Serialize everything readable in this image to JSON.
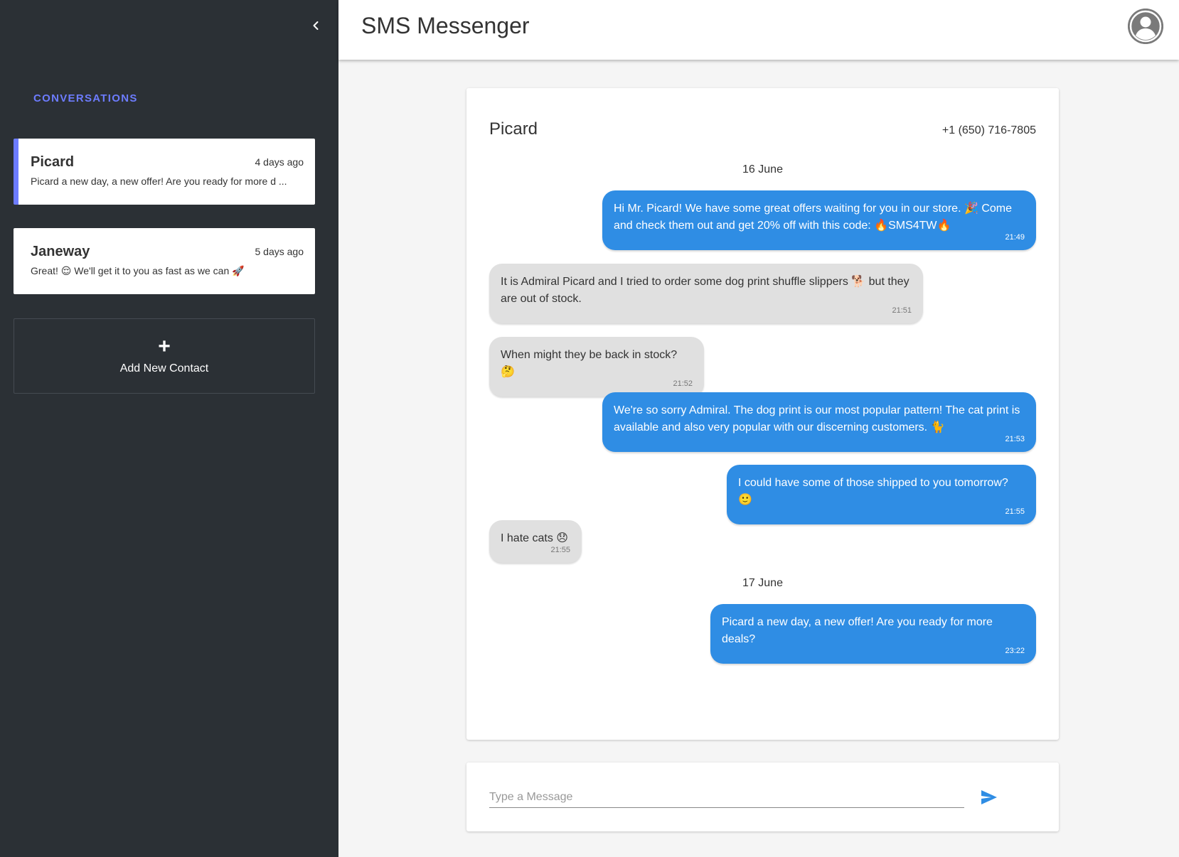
{
  "sidebar": {
    "section_title": "CONVERSATIONS",
    "conversations": [
      {
        "name": "Picard",
        "time": "4 days ago",
        "preview": "Picard a new day, a new offer! Are you ready for more d ...",
        "active": true
      },
      {
        "name": "Janeway",
        "time": "5 days ago",
        "preview": "Great! 😌 We'll get it to you as fast as we can 🚀",
        "active": false
      }
    ],
    "add_contact_icon": "+",
    "add_contact_label": "Add New Contact"
  },
  "header": {
    "title": "SMS Messenger"
  },
  "chat": {
    "contact_name": "Picard",
    "contact_phone": "+1 (650) 716-7805",
    "date_1": "16 June",
    "date_2": "17 June",
    "messages": [
      {
        "direction": "out",
        "text": "Hi Mr. Picard! We have some great offers waiting for you in our store. 🎉 Come and check them out and get 20% off with this code: 🔥SMS4TW🔥",
        "time": "21:49"
      },
      {
        "direction": "in",
        "text": "It is Admiral Picard and I tried to order some dog print shuffle slippers 🐕 but they are out of stock.",
        "time": "21:51"
      },
      {
        "direction": "in",
        "text": "When might they be back in stock? 🤔",
        "time": "21:52"
      },
      {
        "direction": "out",
        "text": "We're so sorry Admiral. The dog print is our most popular pattern! The cat print is available and also very popular with our discerning customers. 🐈",
        "time": "21:53"
      },
      {
        "direction": "out",
        "text": "I could have some of those shipped to you tomorrow? 🙂",
        "time": "21:55"
      },
      {
        "direction": "in",
        "text": "I hate cats 😞",
        "time": "21:55"
      },
      {
        "direction": "out",
        "text": "Picard a new day, a new offer! Are you ready for more deals?",
        "time": "23:22"
      }
    ]
  },
  "composer": {
    "placeholder": "Type a Message",
    "value": ""
  },
  "colors": {
    "sidebar_bg": "#2b3035",
    "accent": "#6d7cff",
    "outgoing_bubble": "#2f8de4",
    "incoming_bubble": "#e0e0e0"
  },
  "icons": {
    "collapse": "chevron-left-icon",
    "avatar": "account-circle-icon",
    "add": "plus-icon",
    "send": "send-icon"
  }
}
